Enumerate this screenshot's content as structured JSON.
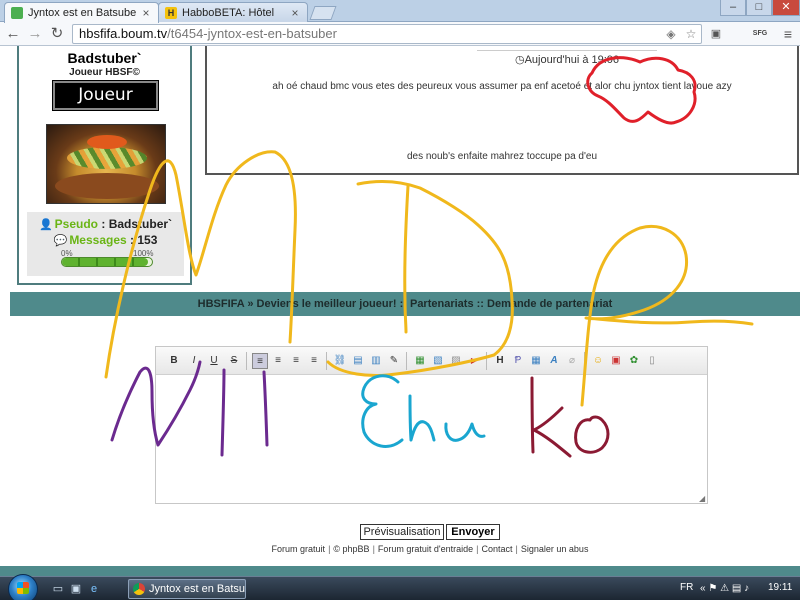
{
  "browser": {
    "tabs": [
      {
        "title": "Jyntox est en Batsuber`",
        "active": true
      },
      {
        "title": "HabboBETA: Hôtel",
        "active": false
      }
    ],
    "favicon_habbo_letter": "H",
    "url_host": "hbsfifa.boum.tv",
    "url_path": "/t6454-jyntox-est-en-batsuber",
    "ext_label": "SFG"
  },
  "profile": {
    "username": "Badstuber`",
    "rank": "Joueur HBSF©",
    "rank_badge": "Joueur",
    "pseudo_label": "Pseudo",
    "pseudo_value": ": Badstuber`",
    "messages_label": "Messages",
    "messages_value": ": 153",
    "progress_min_label": "0%",
    "progress_max_label": "100%",
    "progress_value": 0.95
  },
  "post": {
    "date": "Aujourd'hui à 19:06",
    "line1": "ah oé chaud bmc vous etes des peureux vous assumer pa enf acetoé et alor chu jyntox tient lavoue azy",
    "line2": "des noub's enfaite mahrez toccupe pa d'eu"
  },
  "breadcrumb": "HBSFIFA » Deviens le meilleur joueur! :: Partenariats :: Demande de partenariat",
  "editor": {
    "text": ""
  },
  "buttons": {
    "preview": "Prévisualisation",
    "send": "Envoyer"
  },
  "footer": {
    "links": [
      "Forum gratuit",
      "© phpBB",
      "Forum gratuit d'entraide",
      "Contact",
      "Signaler un abus"
    ]
  },
  "taskbar": {
    "task_label": "Jyntox est en Batsub...",
    "lang": "FR",
    "clock": "19:11"
  },
  "overlay_colors": {
    "yellow": "#f0b81c",
    "purple": "#6b2a8f",
    "cyan": "#1aa6d0",
    "maroon": "#8b1a33",
    "red": "#e0202a"
  }
}
